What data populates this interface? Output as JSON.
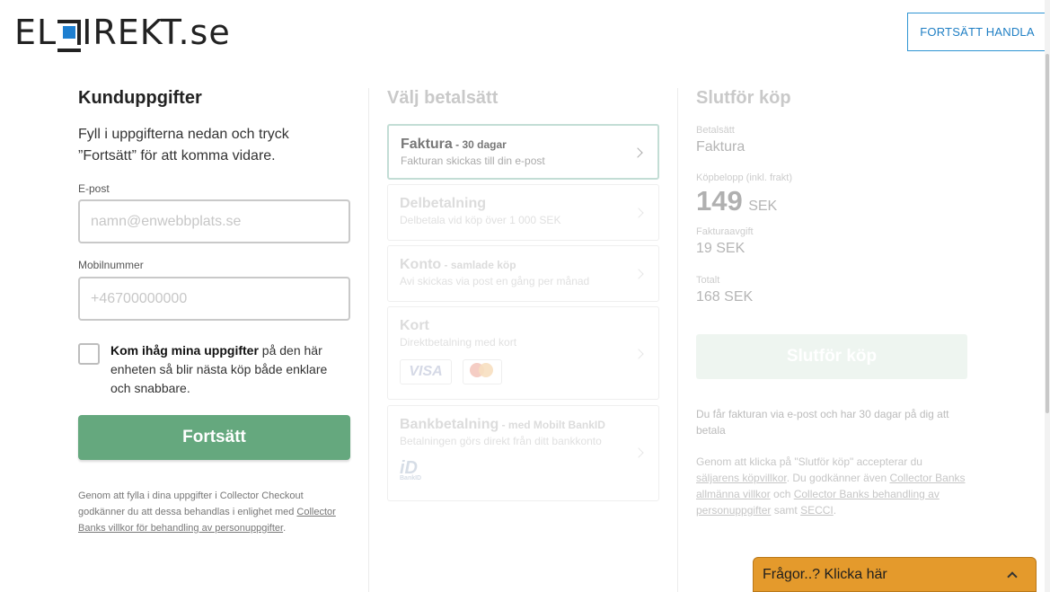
{
  "header": {
    "logo_text_left": "EL",
    "logo_text_right": "IREKT.se",
    "continue_shopping": "FORTSÄTT HANDLA"
  },
  "customer": {
    "title": "Kunduppgifter",
    "intro": "Fyll i uppgifterna nedan och tryck ”Fortsätt” för att komma vidare.",
    "email_label": "E-post",
    "email_placeholder": "namn@enwebbplats.se",
    "email_value": "",
    "phone_label": "Mobilnummer",
    "phone_placeholder": "+46700000000",
    "phone_value": "",
    "remember_bold": "Kom ihåg mina uppgifter",
    "remember_rest": " på den här enheten så blir nästa köp både enklare och snabbare.",
    "remember_checked": false,
    "continue_button": "Fortsätt",
    "legal_text": "Genom att fylla i dina uppgifter i Collector Checkout godkänner du att dessa behandlas i enlighet med ",
    "legal_link": "Collector Banks villkor för behandling av personuppgifter",
    "legal_end": "."
  },
  "payment": {
    "title": "Välj betalsätt",
    "methods": [
      {
        "name": "Faktura",
        "sub": " - 30 dagar",
        "desc": "Fakturan skickas till din e-post",
        "selected": true
      },
      {
        "name": "Delbetalning",
        "sub": "",
        "desc": "Delbetala vid köp över 1 000 SEK",
        "selected": false
      },
      {
        "name": "Konto",
        "sub": " - samlade köp",
        "desc": "Avi skickas via post en gång per månad",
        "selected": false
      },
      {
        "name": "Kort",
        "sub": "",
        "desc": "Direktbetalning med kort",
        "selected": false
      },
      {
        "name": "Bankbetalning",
        "sub": " - med Mobilt BankID",
        "desc": "Betalningen görs direkt från ditt bankkonto",
        "selected": false
      }
    ],
    "visa_label": "VISA",
    "bankid_label": "BankID",
    "mastercard_icon": "mastercard-icon"
  },
  "summary": {
    "title": "Slutför köp",
    "method_label": "Betalsätt",
    "method_value": "Faktura",
    "amount_label": "Köpbelopp (inkl. frakt)",
    "amount_value": "149",
    "amount_currency": "SEK",
    "fee_label": "Fakturaavgift",
    "fee_value": "19 SEK",
    "total_label": "Totalt",
    "total_value": "168 SEK",
    "finish_button": "Slutför köp",
    "info_text": "Du får fakturan via e-post och har 30 dagar på dig att betala",
    "legal_1": "Genom att klicka på \"Slutför köp\" accepterar du ",
    "legal_link_1": "säljarens köpvillkor",
    "legal_2": ". Du godkänner även ",
    "legal_link_2": "Collector Banks allmänna villkor",
    "legal_3": " och ",
    "legal_link_3": "Collector Banks behandling av personuppgifter",
    "legal_4": " samt ",
    "legal_link_4": "SECCI",
    "legal_5": "."
  },
  "help": {
    "label": "Frågor..? Klicka här"
  },
  "colors": {
    "accent": "#65a87e",
    "link_blue": "#1f7fc4",
    "help_orange": "#e49a2c",
    "logo_blue": "#1e7fd0"
  }
}
